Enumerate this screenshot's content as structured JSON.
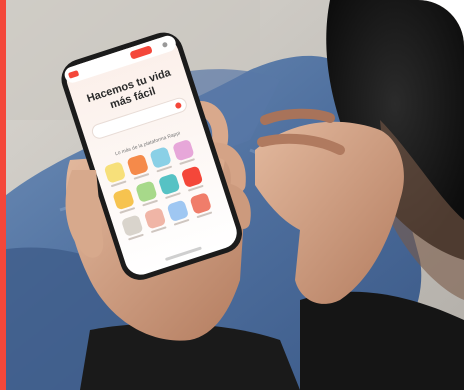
{
  "photo": {
    "subject": "person-holding-smartphone",
    "accent_color": "#f4473a",
    "app": {
      "hero_line_1": "Hacemos tu vida",
      "hero_line_2": "más fácil",
      "section_title": "Lo más de la plataforma Rappi",
      "service_tiles": [
        {
          "icon": "grocery-icon",
          "color": "#f7e07a"
        },
        {
          "icon": "food-icon",
          "color": "#f58a4a"
        },
        {
          "icon": "chart-icon",
          "color": "#8ad0e6"
        },
        {
          "icon": "beauty-icon",
          "color": "#e7a7d9"
        },
        {
          "icon": "box-icon",
          "color": "#f6c34f"
        },
        {
          "icon": "drink-icon",
          "color": "#a7d98a"
        },
        {
          "icon": "headphones-icon",
          "color": "#56c2c4"
        },
        {
          "icon": "gift-icon",
          "color": "#f4473a"
        },
        {
          "icon": "paw-icon",
          "color": "#d9d4cc"
        },
        {
          "icon": "bag-icon",
          "color": "#f0b5a6"
        },
        {
          "icon": "travel-icon",
          "color": "#9fc7f2"
        },
        {
          "icon": "cash-icon",
          "color": "#f07d6a"
        }
      ]
    }
  }
}
